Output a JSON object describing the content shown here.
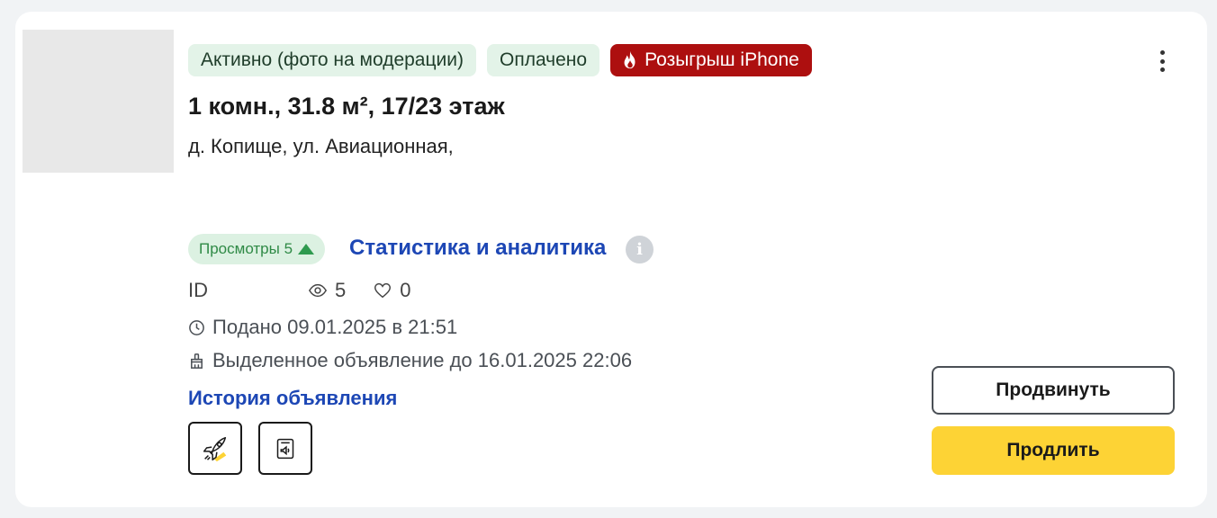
{
  "listing": {
    "badges": {
      "status": "Активно (фото на модерации)",
      "paid": "Оплачено",
      "promo": "Розыгрыш iPhone"
    },
    "title": "1 комн., 31.8 м², 17/23 этаж",
    "address": "д. Копище, ул. Авиационная,",
    "views_badge": "Просмотры 5",
    "stats_link": "Статистика и аналитика",
    "info_icon": "i",
    "id_label": "ID",
    "views_count": "5",
    "likes_count": "0",
    "posted": "Подано 09.01.2025 в 21:51",
    "highlighted": "Выделенное объявление до 16.01.2025 22:06",
    "history_link": "История объявления"
  },
  "actions": {
    "promote": "Продвинуть",
    "extend": "Продлить"
  },
  "icons": {
    "menu": "kebab-menu-icon",
    "fire": "fire-icon",
    "views_up": "triangle-up-icon",
    "info": "info-icon",
    "eye": "eye-icon",
    "heart": "heart-icon",
    "clock": "clock-icon",
    "highlight": "brush-icon",
    "boost": "rocket-icon",
    "announce": "speaker-icon"
  },
  "colors": {
    "promo_badge": "#ad0f0f",
    "green_badge": "#e3f3e8",
    "views_badge": "#dcf1e2",
    "link": "#1d47b5",
    "extend_button": "#fdd335"
  }
}
